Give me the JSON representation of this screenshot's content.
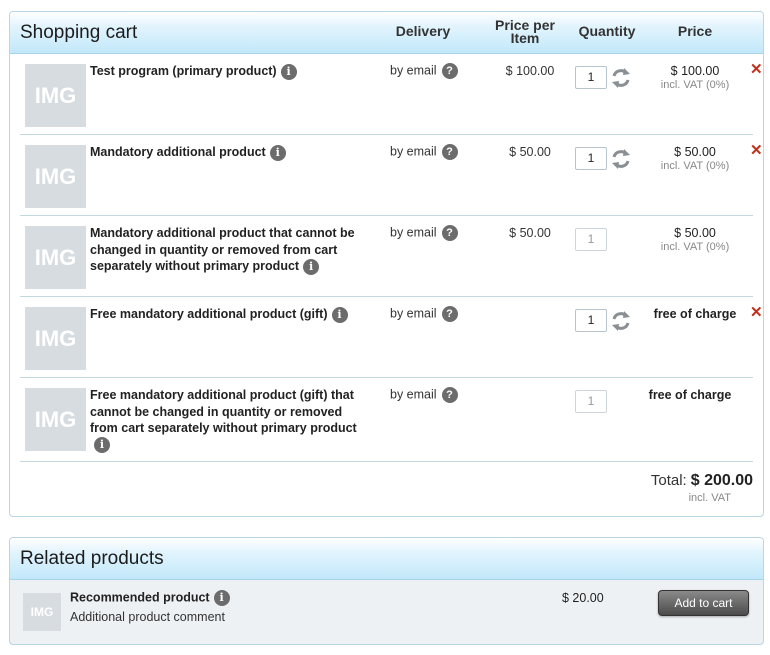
{
  "cart": {
    "title": "Shopping cart",
    "columns": {
      "delivery": "Delivery",
      "price_per_item_1": "Price per",
      "price_per_item_2": "Item",
      "quantity": "Quantity",
      "price": "Price"
    },
    "items": [
      {
        "name": "Test program (primary product)",
        "thumb": "IMG",
        "delivery": "by email",
        "unit_price": "$ 100.00",
        "quantity": "1",
        "price": "$ 100.00",
        "vat": "incl. VAT (0%)",
        "editable": true,
        "removable": true
      },
      {
        "name": "Mandatory additional product",
        "thumb": "IMG",
        "delivery": "by email",
        "unit_price": "$ 50.00",
        "quantity": "1",
        "price": "$ 50.00",
        "vat": "incl. VAT (0%)",
        "editable": true,
        "removable": true
      },
      {
        "name": "Mandatory additional product that cannot be changed in quantity or removed from cart separately without primary product",
        "thumb": "IMG",
        "delivery": "by email",
        "unit_price": "$ 50.00",
        "quantity": "1",
        "price": "$ 50.00",
        "vat": "incl. VAT (0%)",
        "editable": false,
        "removable": false
      },
      {
        "name": "Free mandatory additional product (gift)",
        "thumb": "IMG",
        "delivery": "by email",
        "unit_price": "",
        "quantity": "1",
        "price": "free of charge",
        "vat": "",
        "editable": true,
        "removable": true
      },
      {
        "name": "Free mandatory additional product (gift) that cannot be changed in quantity or removed from cart separately without primary product",
        "thumb": "IMG",
        "delivery": "by email",
        "unit_price": "",
        "quantity": "1",
        "price": "free of charge",
        "vat": "",
        "editable": false,
        "removable": false
      }
    ],
    "total_label": "Total:",
    "total_amount": "$ 200.00",
    "total_vat": "incl. VAT"
  },
  "related": {
    "title": "Related products",
    "items": [
      {
        "name": "Recommended product",
        "thumb": "IMG",
        "comment": "Additional product comment",
        "price": "$ 20.00",
        "button": "Add to cart"
      }
    ]
  },
  "icons": {
    "info": "i",
    "help": "?",
    "remove": "✕"
  },
  "colors": {
    "remove": "#c0311b",
    "header_gradient_end": "#c2e8fa",
    "button_dark": "#4b4b4b"
  }
}
